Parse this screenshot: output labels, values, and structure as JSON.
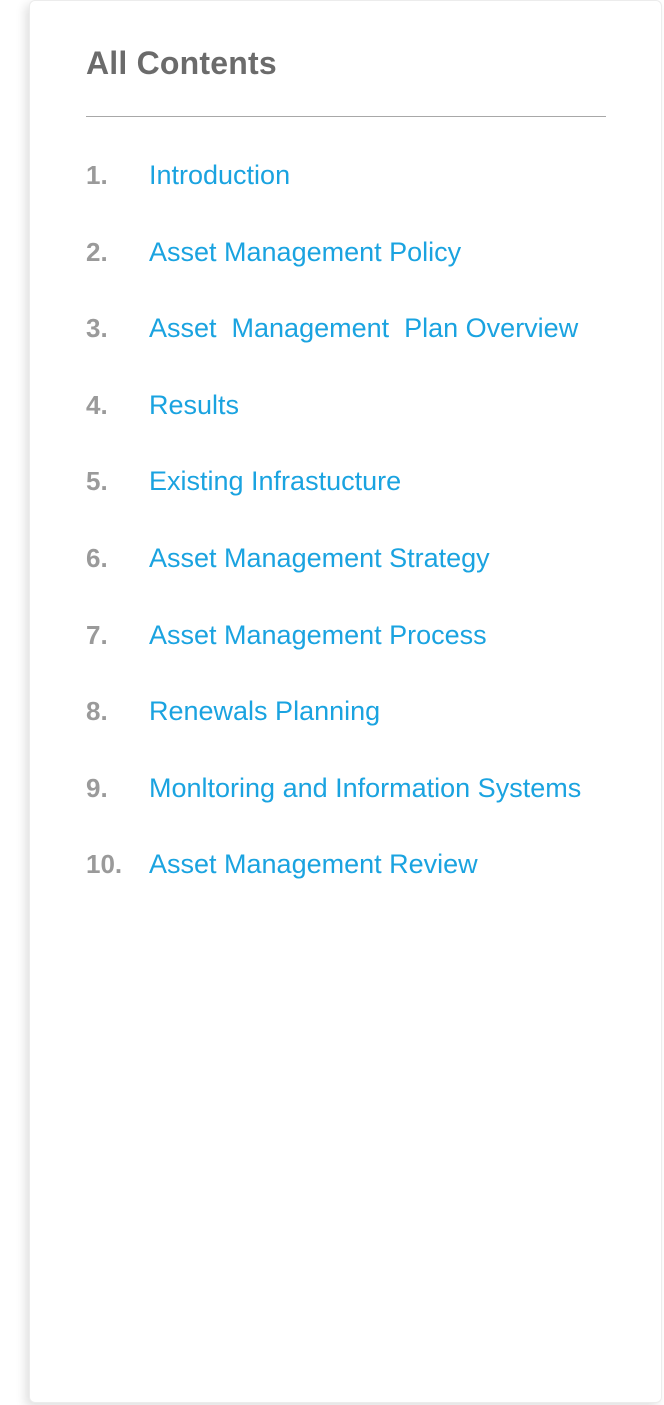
{
  "panel": {
    "title": "All Contents"
  },
  "toc": [
    {
      "number": "1.",
      "label": "Introduction"
    },
    {
      "number": "2.",
      "label": "Asset Management Policy"
    },
    {
      "number": "3.",
      "label": "Asset  Management  Plan Overview"
    },
    {
      "number": "4.",
      "label": "Results"
    },
    {
      "number": "5.",
      "label": "Existing Infrastucture"
    },
    {
      "number": "6.",
      "label": "Asset Management Strategy"
    },
    {
      "number": "7.",
      "label": "Asset Management Process"
    },
    {
      "number": "8.",
      "label": "Renewals Planning"
    },
    {
      "number": "9.",
      "label": "Monltoring and Information Systems"
    },
    {
      "number": "10.",
      "label": "Asset Management Review"
    }
  ],
  "colors": {
    "link": "#1aa3e0",
    "number": "#9a9a9a",
    "title": "#6b6b6b"
  }
}
